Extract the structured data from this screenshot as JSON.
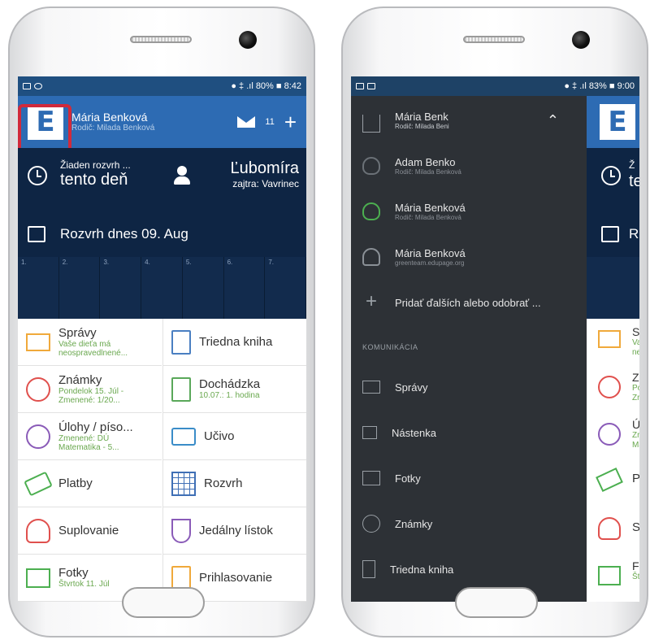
{
  "left_phone": {
    "status": {
      "left_icons": [
        "image-icon",
        "whatsapp-icon"
      ],
      "right": "● ‡ .ıl 80% ■ 8:42"
    },
    "header": {
      "logo": "E",
      "user_name": "Mária Benková",
      "user_sub": "Rodič: Milada Benková",
      "message_count": "11",
      "add": "+"
    },
    "timetable": {
      "today_line1": "Žiaden rozvrh ...",
      "today_line2": "tento deň",
      "teacher_name": "Ľubomíra",
      "teacher_sub": "zajtra: Vavrinec",
      "schedule_title": "Rozvrh dnes 09. Aug",
      "periods": [
        "1.",
        "2.",
        "3.",
        "4.",
        "5.",
        "6.",
        "7."
      ]
    },
    "tiles": [
      {
        "title": "Správy",
        "sub": "Vaše dieťa má neospravedlnené...",
        "icon": "mail-icon",
        "color": "#f0a93b"
      },
      {
        "title": "Triedna kniha",
        "sub": "",
        "icon": "book-icon",
        "color": "#4a7fc1"
      },
      {
        "title": "Známky",
        "sub": "Pondelok 15. Júl - Zmenené: 1/20...",
        "icon": "grades-icon",
        "color": "#e0504d"
      },
      {
        "title": "Dochádzka",
        "sub": "10.07.: 1. hodina",
        "icon": "attendance-icon",
        "color": "#5aa85a"
      },
      {
        "title": "Úlohy / píso...",
        "sub": "Zmenené: DÚ Matematika - 5...",
        "icon": "tasks-clock-icon",
        "color": "#8a5bb8"
      },
      {
        "title": "Učivo",
        "sub": "",
        "icon": "briefcase-icon",
        "color": "#3a8cc8"
      },
      {
        "title": "Platby",
        "sub": "",
        "icon": "payment-icon",
        "color": "#4caf50"
      },
      {
        "title": "Rozvrh",
        "sub": "",
        "icon": "timetable-icon",
        "color": "#3f6fb5"
      },
      {
        "title": "Suplovanie",
        "sub": "",
        "icon": "substitution-icon",
        "color": "#e0504d"
      },
      {
        "title": "Jedálny lístok",
        "sub": "",
        "icon": "menu-food-icon",
        "color": "#8a5bb8"
      },
      {
        "title": "Fotky",
        "sub": "Štvrtok 11. Júl",
        "icon": "photos-icon",
        "color": "#4caf50"
      },
      {
        "title": "Prihlasovanie",
        "sub": "",
        "icon": "clipboard-icon",
        "color": "#f0a93b"
      }
    ]
  },
  "right_phone": {
    "status": {
      "left_icons": [
        "image-icon",
        "image-icon"
      ],
      "right": "● ‡ .ıl 83% ■ 9:00"
    },
    "drawer": {
      "account": {
        "name": "Mária Benk",
        "sub": "Rodič: Milada Beni"
      },
      "accounts": [
        {
          "name": "Adam Benko",
          "sub": "Rodič: Milada Benková",
          "icon": "masks-icon",
          "color": "#6b7177"
        },
        {
          "name": "Mária Benková",
          "sub": "Rodič: Milada Benková",
          "icon": "masks-icon",
          "color": "#4caf50"
        },
        {
          "name": "Mária Benková",
          "sub": "greenteam.edupage.org",
          "icon": "person-outline-icon",
          "color": "#8a9096"
        }
      ],
      "add_label": "Pridať ďalších alebo odobrať ...",
      "section_title": "KOMUNIKÁCIA",
      "items": [
        {
          "label": "Správy",
          "icon": "mail-icon"
        },
        {
          "label": "Nástenka",
          "icon": "board-icon"
        },
        {
          "label": "Fotky",
          "icon": "photos-icon"
        },
        {
          "label": "Známky",
          "icon": "grades-icon"
        },
        {
          "label": "Triedna kniha",
          "icon": "book-icon"
        }
      ]
    },
    "behind": {
      "logo": "E",
      "letters": [
        "Ž",
        "te",
        "R",
        "Sp",
        "Va",
        "ne",
        "Zr",
        "Po",
        "Zr",
        "Úl",
        "Zr",
        "Ma",
        "Pl",
        "Su",
        "Fo",
        "Št"
      ]
    }
  }
}
